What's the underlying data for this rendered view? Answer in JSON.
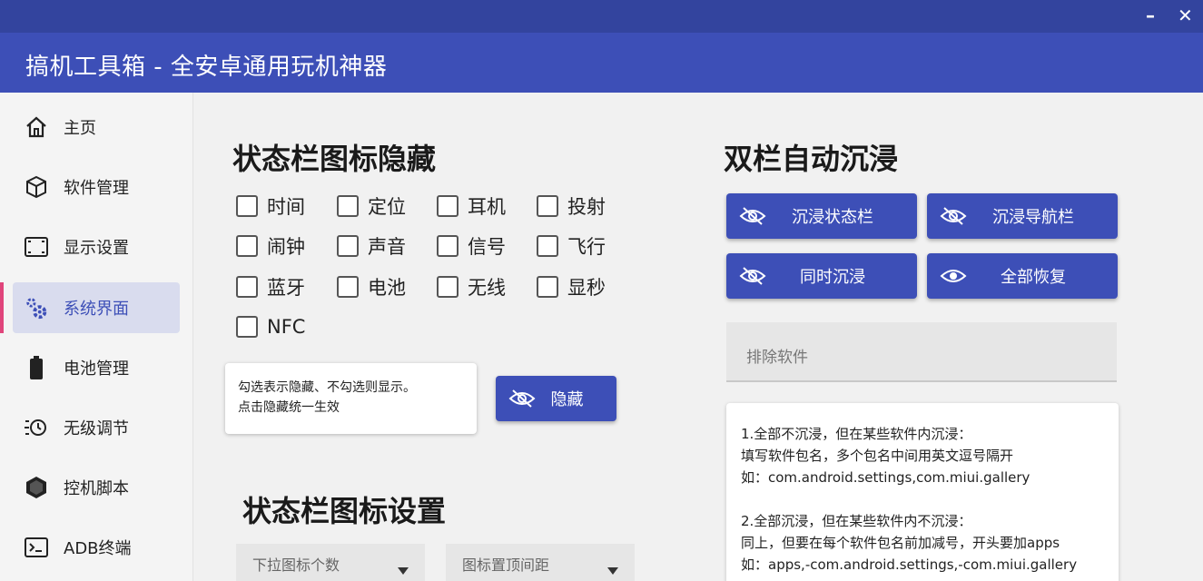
{
  "window": {
    "minimize": "–",
    "close": "✕",
    "title": "搞机工具箱 - 全安卓通用玩机神器"
  },
  "sidebar": {
    "items": [
      {
        "label": "主页",
        "icon": "home-icon"
      },
      {
        "label": "软件管理",
        "icon": "package-icon"
      },
      {
        "label": "显示设置",
        "icon": "screen-icon"
      },
      {
        "label": "系统界面",
        "icon": "gears-icon"
      },
      {
        "label": "电池管理",
        "icon": "battery-icon"
      },
      {
        "label": "无级调节",
        "icon": "brightness-icon"
      },
      {
        "label": "控机脚本",
        "icon": "hexagon-icon"
      },
      {
        "label": "ADB终端",
        "icon": "terminal-icon"
      }
    ],
    "active_index": 3
  },
  "statusbar_hide": {
    "heading": "状态栏图标隐藏",
    "options": [
      "时间",
      "定位",
      "耳机",
      "投射",
      "闹钟",
      "声音",
      "信号",
      "飞行",
      "蓝牙",
      "电池",
      "无线",
      "显秒",
      "NFC"
    ],
    "note_line1": "勾选表示隐藏、不勾选则显示。",
    "note_line2": "点击隐藏统一生效",
    "hide_button": "隐藏"
  },
  "statusbar_settings": {
    "heading": "状态栏图标设置",
    "select1": "下拉图标个数",
    "select2": "图标置顶间距"
  },
  "immersive": {
    "heading": "双栏自动沉浸",
    "btn_status": "沉浸状态栏",
    "btn_nav": "沉浸导航栏",
    "btn_both": "同时沉浸",
    "btn_restore": "全部恢复",
    "exclude_placeholder": "排除软件",
    "info": {
      "p1_l1": "1.全部不沉浸，但在某些软件内沉浸：",
      "p1_l2": "填写软件包名，多个包名中间用英文逗号隔开",
      "p1_l3": "如：com.android.settings,com.miui.gallery",
      "p2_l1": "2.全部沉浸，但在某些软件内不沉浸：",
      "p2_l2": "同上，但要在每个软件包名前加减号，开头要加apps",
      "p2_l3": "如：apps,-com.android.settings,-com.miui.gallery"
    }
  },
  "colors": {
    "accent": "#3d4fb7",
    "titlebar_top": "#33449e",
    "active_indicator": "#e0457b",
    "active_bg": "#d9dcee"
  }
}
